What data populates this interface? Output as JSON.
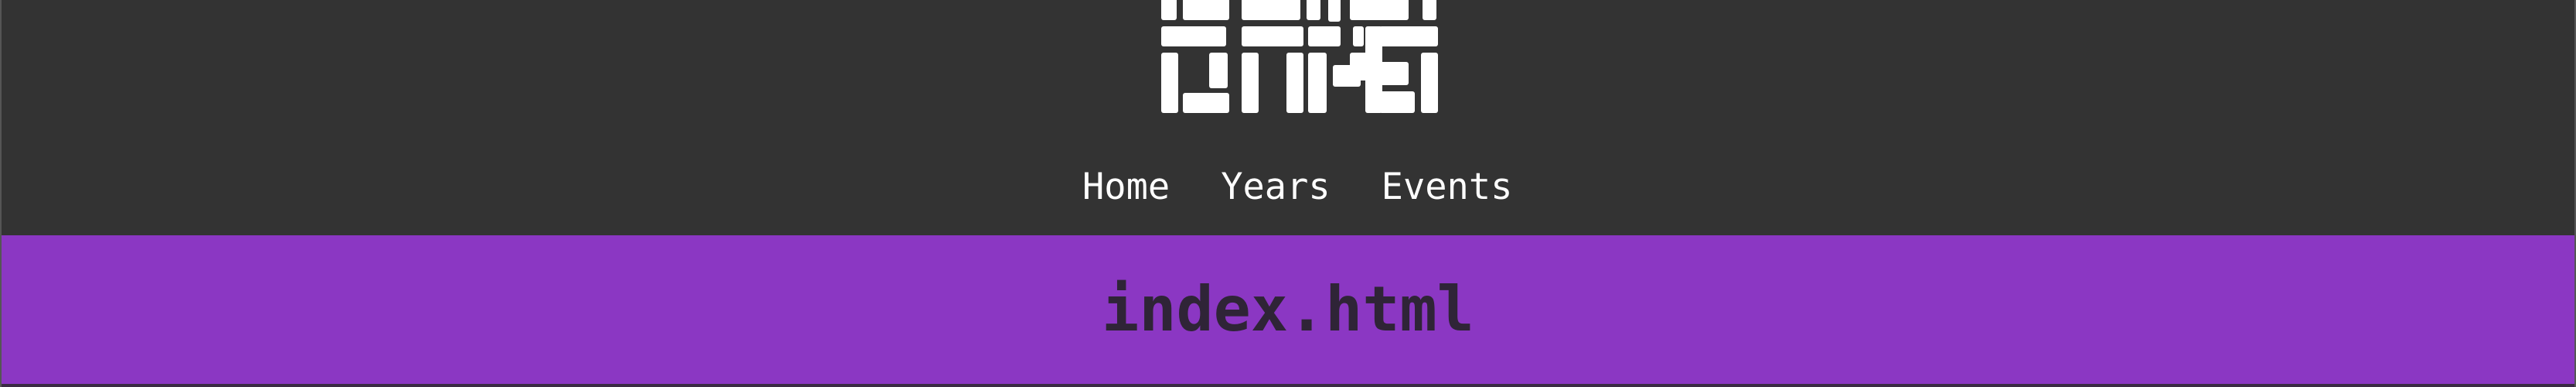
{
  "colors": {
    "header_bg": "#333333",
    "banner_bg": "#8b37c3",
    "banner_text": "#2f2437",
    "nav_text": "#ffffff",
    "logo_fill": "#ffffff"
  },
  "logo": {
    "icon": "brick-block-logo-icon"
  },
  "nav": {
    "items": [
      {
        "label": "Home"
      },
      {
        "label": "Years"
      },
      {
        "label": "Events"
      }
    ]
  },
  "banner": {
    "title": "index.html"
  }
}
